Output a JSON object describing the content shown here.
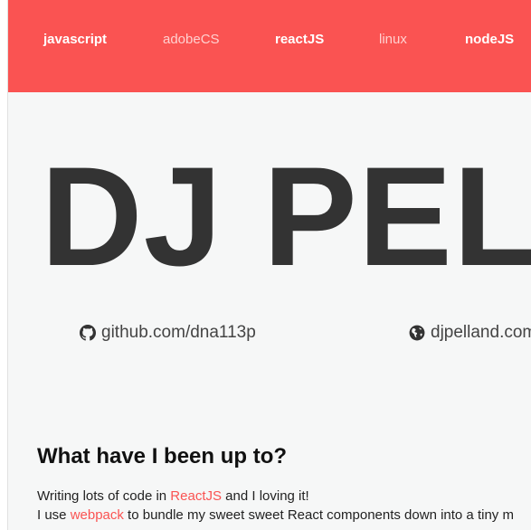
{
  "nav": {
    "items": [
      {
        "label": "javascript",
        "style": "bold"
      },
      {
        "label": "adobeCS",
        "style": "light"
      },
      {
        "label": "reactJS",
        "style": "bold"
      },
      {
        "label": "linux",
        "style": "light"
      },
      {
        "label": "nodeJS",
        "style": "bold"
      }
    ]
  },
  "hero": {
    "title": "DJ PELLAND"
  },
  "links": [
    {
      "icon": "github-icon",
      "text": "github.com/dna113p"
    },
    {
      "icon": "globe-icon",
      "text": "djpelland.com"
    }
  ],
  "section": {
    "heading": "What have I been up to?",
    "line1": {
      "before": "Writing lots of code in ",
      "link": "ReactJS",
      "after": " and I loving it!"
    },
    "line2": {
      "before": "I use ",
      "link": "webpack",
      "after": " to bundle my sweet sweet React components down into a tiny m"
    }
  },
  "colors": {
    "accent": "#fa5352",
    "background": "#f6f7f7",
    "text": "#333333"
  }
}
